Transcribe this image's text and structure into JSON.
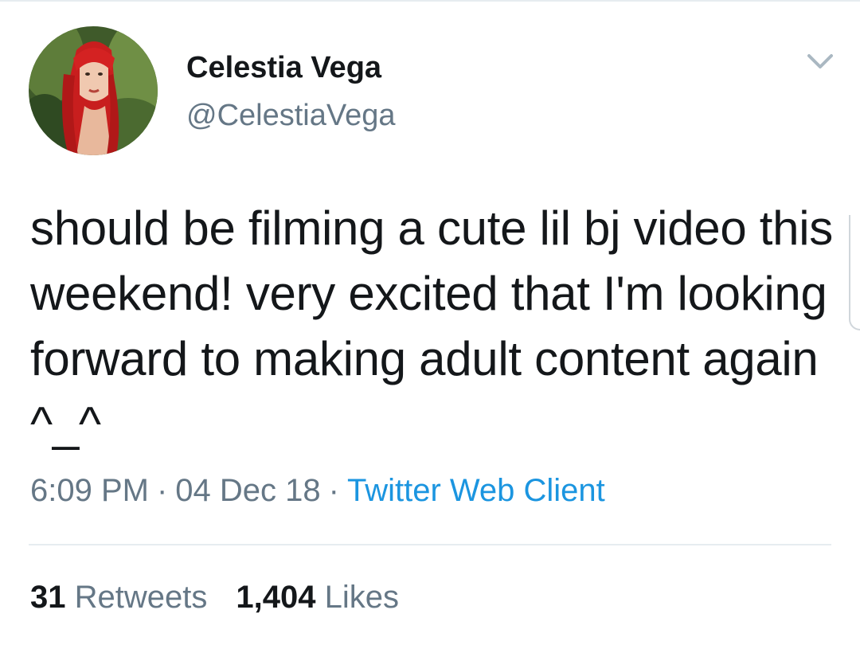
{
  "user": {
    "display_name": "Celestia Vega",
    "handle": "@CelestiaVega",
    "avatar_icon": "profile-avatar-photo"
  },
  "tweet": {
    "text": "should be filming a cute lil bj video this weekend! very excited that I'm looking forward to making adult content again ^_^"
  },
  "meta": {
    "time": "6:09 PM",
    "separator": "·",
    "date": "04 Dec 18",
    "source": "Twitter Web Client"
  },
  "stats": {
    "retweets_count": "31",
    "retweets_label": "Retweets",
    "likes_count": "1,404",
    "likes_label": "Likes"
  },
  "icons": {
    "menu": "chevron-down-icon"
  },
  "colors": {
    "text_primary": "#14171a",
    "text_secondary": "#657786",
    "link": "#1b95e0",
    "divider": "#e6ecf0"
  }
}
